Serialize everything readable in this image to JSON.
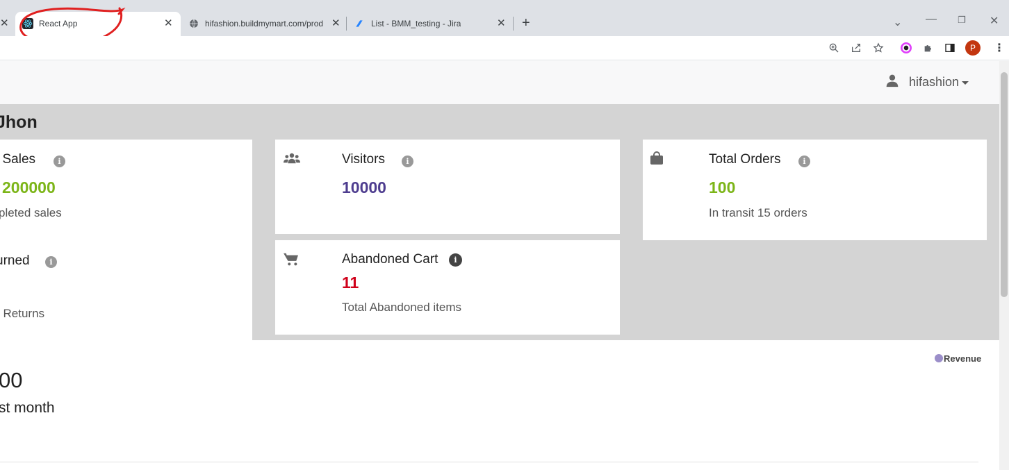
{
  "browser": {
    "tabs": [
      {
        "title": "React App",
        "active": true
      },
      {
        "title": "hifashion.buildmymart.com/prod",
        "active": false
      },
      {
        "title": "List - BMM_testing - Jira",
        "active": false
      }
    ],
    "new_tab_label": "+",
    "profile_initial": "P"
  },
  "navbar": {
    "username": "hifashion"
  },
  "dashboard": {
    "title": "Jhon",
    "cards": {
      "sales": {
        "title": "l Sales",
        "value": "200000",
        "sub": "pleted sales",
        "value_color": "#7cb518"
      },
      "returned": {
        "title": "urned",
        "sub": "l Returns"
      },
      "visitors": {
        "title": "Visitors",
        "value": "10000",
        "value_color": "#4e3d8f"
      },
      "orders": {
        "title": "Total Orders",
        "value": "100",
        "sub": "In transit 15 orders",
        "value_color": "#7cb518"
      },
      "cart": {
        "title": "Abandoned Cart",
        "value": "11",
        "sub": "Total Abandoned items",
        "value_color": "#d0021b"
      }
    },
    "revenue": {
      "amount": "00",
      "period": "st month",
      "legend": "Revenue",
      "legend_color": "#9b8ec9"
    }
  }
}
